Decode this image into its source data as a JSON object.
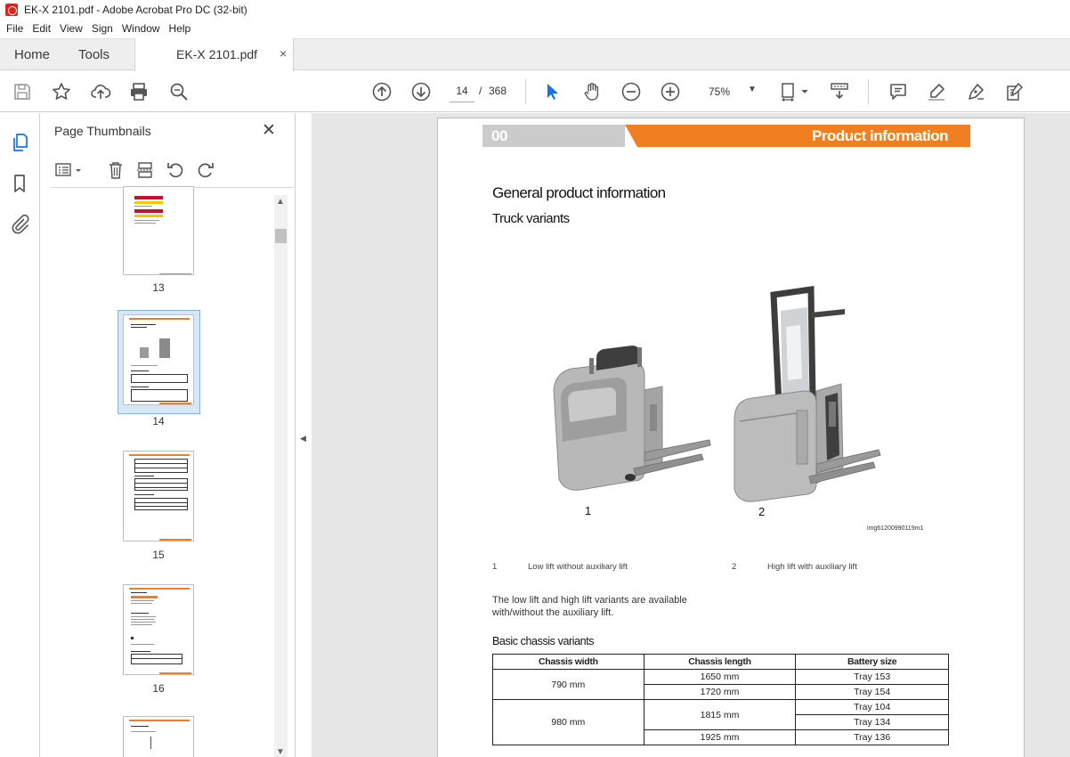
{
  "window": {
    "title": "EK-X 2101.pdf - Adobe Acrobat Pro DC (32-bit)"
  },
  "menu": [
    "File",
    "Edit",
    "View",
    "Sign",
    "Window",
    "Help"
  ],
  "tabs": {
    "home": "Home",
    "tools": "Tools",
    "document": "EK-X 2101.pdf",
    "close": "×"
  },
  "toolbar": {
    "current_page": "14",
    "page_separator": "/",
    "total_pages": "368",
    "zoom": "75%"
  },
  "thumbnails_panel": {
    "title": "Page Thumbnails",
    "close": "✕",
    "pages": [
      {
        "label": "13"
      },
      {
        "label": "14",
        "selected": true
      },
      {
        "label": "15"
      },
      {
        "label": "16"
      }
    ]
  },
  "document": {
    "chapter_number": "00",
    "chapter_title": "Product information",
    "heading": "General product information",
    "subheading": "Truck variants",
    "figure": {
      "label_1": "1",
      "label_2": "2",
      "image_id": "img61200990119m1",
      "legend": [
        {
          "num": "1",
          "text": "Low lift without auxiliary lift"
        },
        {
          "num": "2",
          "text": "High lift with auxiliary lift"
        }
      ]
    },
    "paragraph": "The low lift and high lift variants are available with/without the auxiliary lift.",
    "table_title": "Basic chassis variants",
    "table": {
      "headers": [
        "Chassis width",
        "Chassis length",
        "Battery size"
      ],
      "width_790": "790 mm",
      "width_980": "980 mm",
      "len_1650": "1650 mm",
      "len_1720": "1720 mm",
      "len_1815": "1815 mm",
      "len_1925": "1925 mm",
      "tray_153": "Tray 153",
      "tray_154": "Tray 154",
      "tray_104": "Tray 104",
      "tray_134": "Tray 134",
      "tray_136": "Tray 136"
    }
  },
  "colors": {
    "accent_orange": "#f07f22",
    "acrobat_red": "#d9261c",
    "selection_blue": "#d6e8f8"
  }
}
